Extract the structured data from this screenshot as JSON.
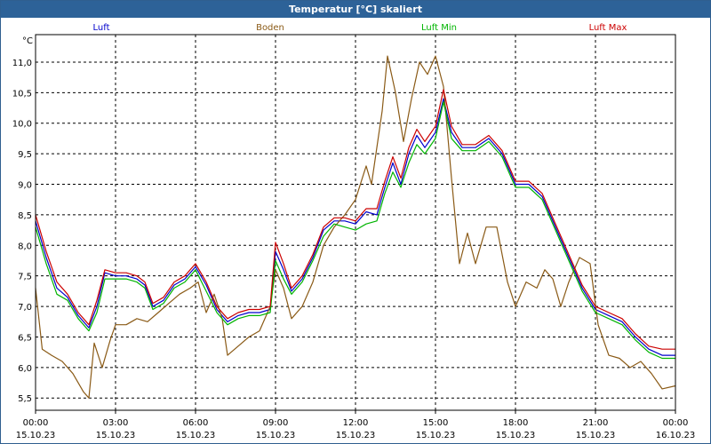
{
  "window": {
    "title": "Temperatur [°C] skaliert"
  },
  "chart_data": {
    "type": "line",
    "title": "Temperatur [°C] skaliert",
    "ylabel": "°C",
    "ylim": [
      5.3,
      11.45
    ],
    "xlim": [
      0,
      24
    ],
    "grid": true,
    "y_ticks": [
      "5,5",
      "6,0",
      "6,5",
      "7,0",
      "7,5",
      "8,0",
      "8,5",
      "9,0",
      "9,5",
      "10,0",
      "10,5",
      "11,0"
    ],
    "x_ticks": [
      {
        "time": "00:00",
        "date": "15.10.23"
      },
      {
        "time": "03:00",
        "date": "15.10.23"
      },
      {
        "time": "06:00",
        "date": "15.10.23"
      },
      {
        "time": "09:00",
        "date": "15.10.23"
      },
      {
        "time": "12:00",
        "date": "15.10.23"
      },
      {
        "time": "15:00",
        "date": "15.10.23"
      },
      {
        "time": "18:00",
        "date": "15.10.23"
      },
      {
        "time": "21:00",
        "date": "15.10.23"
      },
      {
        "time": "00:00",
        "date": "16.10.23"
      }
    ],
    "series": [
      {
        "name": "Luft",
        "color": "#0000cc",
        "points": [
          [
            0,
            8.4
          ],
          [
            0.4,
            7.8
          ],
          [
            0.8,
            7.3
          ],
          [
            1.2,
            7.15
          ],
          [
            1.6,
            6.85
          ],
          [
            2.0,
            6.65
          ],
          [
            2.3,
            7.0
          ],
          [
            2.6,
            7.55
          ],
          [
            3.0,
            7.5
          ],
          [
            3.4,
            7.5
          ],
          [
            3.8,
            7.45
          ],
          [
            4.1,
            7.35
          ],
          [
            4.4,
            7.0
          ],
          [
            4.8,
            7.1
          ],
          [
            5.2,
            7.35
          ],
          [
            5.6,
            7.45
          ],
          [
            6.0,
            7.65
          ],
          [
            6.4,
            7.35
          ],
          [
            6.8,
            6.95
          ],
          [
            7.2,
            6.75
          ],
          [
            7.6,
            6.85
          ],
          [
            8.0,
            6.9
          ],
          [
            8.4,
            6.9
          ],
          [
            8.8,
            6.95
          ],
          [
            9.0,
            7.9
          ],
          [
            9.3,
            7.6
          ],
          [
            9.6,
            7.25
          ],
          [
            10.0,
            7.45
          ],
          [
            10.4,
            7.8
          ],
          [
            10.8,
            8.25
          ],
          [
            11.2,
            8.4
          ],
          [
            11.6,
            8.4
          ],
          [
            12.0,
            8.35
          ],
          [
            12.4,
            8.55
          ],
          [
            12.8,
            8.5
          ],
          [
            13.1,
            8.95
          ],
          [
            13.4,
            9.35
          ],
          [
            13.7,
            9.0
          ],
          [
            14.0,
            9.5
          ],
          [
            14.3,
            9.8
          ],
          [
            14.6,
            9.6
          ],
          [
            15.0,
            9.85
          ],
          [
            15.3,
            10.4
          ],
          [
            15.6,
            9.85
          ],
          [
            16.0,
            9.6
          ],
          [
            16.5,
            9.6
          ],
          [
            17.0,
            9.75
          ],
          [
            17.5,
            9.5
          ],
          [
            18.0,
            9.0
          ],
          [
            18.5,
            9.0
          ],
          [
            19.0,
            8.8
          ],
          [
            19.5,
            8.3
          ],
          [
            20.0,
            7.8
          ],
          [
            20.5,
            7.3
          ],
          [
            21.0,
            6.95
          ],
          [
            21.5,
            6.85
          ],
          [
            22.0,
            6.75
          ],
          [
            22.5,
            6.5
          ],
          [
            23.0,
            6.3
          ],
          [
            23.5,
            6.2
          ],
          [
            24,
            6.2
          ]
        ]
      },
      {
        "name": "Boden",
        "color": "#8a5a16",
        "points": [
          [
            0,
            7.3
          ],
          [
            0.25,
            6.3
          ],
          [
            0.6,
            6.2
          ],
          [
            1.0,
            6.1
          ],
          [
            1.4,
            5.9
          ],
          [
            1.8,
            5.6
          ],
          [
            2.0,
            5.5
          ],
          [
            2.2,
            6.4
          ],
          [
            2.5,
            6.0
          ],
          [
            2.8,
            6.45
          ],
          [
            3.0,
            6.7
          ],
          [
            3.4,
            6.7
          ],
          [
            3.8,
            6.8
          ],
          [
            4.2,
            6.75
          ],
          [
            4.6,
            6.9
          ],
          [
            5.0,
            7.05
          ],
          [
            5.4,
            7.2
          ],
          [
            5.8,
            7.3
          ],
          [
            6.1,
            7.4
          ],
          [
            6.4,
            6.9
          ],
          [
            6.7,
            7.2
          ],
          [
            7.0,
            6.8
          ],
          [
            7.2,
            6.2
          ],
          [
            7.6,
            6.35
          ],
          [
            8.0,
            6.5
          ],
          [
            8.4,
            6.6
          ],
          [
            8.8,
            7.0
          ],
          [
            9.0,
            7.6
          ],
          [
            9.3,
            7.3
          ],
          [
            9.6,
            6.8
          ],
          [
            10.0,
            7.0
          ],
          [
            10.4,
            7.4
          ],
          [
            10.8,
            8.0
          ],
          [
            11.2,
            8.3
          ],
          [
            11.6,
            8.5
          ],
          [
            12.0,
            8.75
          ],
          [
            12.4,
            9.3
          ],
          [
            12.6,
            9.0
          ],
          [
            13.0,
            10.2
          ],
          [
            13.2,
            11.1
          ],
          [
            13.5,
            10.5
          ],
          [
            13.8,
            9.7
          ],
          [
            14.1,
            10.4
          ],
          [
            14.4,
            11.0
          ],
          [
            14.7,
            10.8
          ],
          [
            15.0,
            11.1
          ],
          [
            15.3,
            10.6
          ],
          [
            15.6,
            9.1
          ],
          [
            15.9,
            7.7
          ],
          [
            16.2,
            8.2
          ],
          [
            16.5,
            7.7
          ],
          [
            16.9,
            8.3
          ],
          [
            17.3,
            8.3
          ],
          [
            17.7,
            7.4
          ],
          [
            18.0,
            7.0
          ],
          [
            18.4,
            7.4
          ],
          [
            18.8,
            7.3
          ],
          [
            19.1,
            7.6
          ],
          [
            19.4,
            7.45
          ],
          [
            19.7,
            7.0
          ],
          [
            20.0,
            7.4
          ],
          [
            20.4,
            7.8
          ],
          [
            20.8,
            7.7
          ],
          [
            21.1,
            6.7
          ],
          [
            21.5,
            6.2
          ],
          [
            21.9,
            6.15
          ],
          [
            22.3,
            6.0
          ],
          [
            22.7,
            6.1
          ],
          [
            23.1,
            5.9
          ],
          [
            23.5,
            5.65
          ],
          [
            24,
            5.7
          ]
        ]
      },
      {
        "name": "Luft Min",
        "color": "#00b400",
        "points": [
          [
            0,
            8.3
          ],
          [
            0.4,
            7.7
          ],
          [
            0.8,
            7.2
          ],
          [
            1.2,
            7.1
          ],
          [
            1.6,
            6.8
          ],
          [
            2.0,
            6.6
          ],
          [
            2.3,
            6.9
          ],
          [
            2.6,
            7.45
          ],
          [
            3.0,
            7.45
          ],
          [
            3.4,
            7.45
          ],
          [
            3.8,
            7.4
          ],
          [
            4.1,
            7.3
          ],
          [
            4.4,
            6.95
          ],
          [
            4.8,
            7.05
          ],
          [
            5.2,
            7.3
          ],
          [
            5.6,
            7.4
          ],
          [
            6.0,
            7.6
          ],
          [
            6.4,
            7.25
          ],
          [
            6.8,
            6.9
          ],
          [
            7.2,
            6.7
          ],
          [
            7.6,
            6.8
          ],
          [
            8.0,
            6.85
          ],
          [
            8.4,
            6.85
          ],
          [
            8.8,
            6.9
          ],
          [
            9.0,
            7.75
          ],
          [
            9.3,
            7.45
          ],
          [
            9.6,
            7.2
          ],
          [
            10.0,
            7.4
          ],
          [
            10.4,
            7.75
          ],
          [
            10.8,
            8.15
          ],
          [
            11.2,
            8.35
          ],
          [
            11.6,
            8.3
          ],
          [
            12.0,
            8.25
          ],
          [
            12.4,
            8.35
          ],
          [
            12.8,
            8.4
          ],
          [
            13.1,
            8.85
          ],
          [
            13.4,
            9.2
          ],
          [
            13.7,
            8.95
          ],
          [
            14.0,
            9.35
          ],
          [
            14.3,
            9.65
          ],
          [
            14.6,
            9.5
          ],
          [
            15.0,
            9.75
          ],
          [
            15.3,
            10.35
          ],
          [
            15.6,
            9.75
          ],
          [
            16.0,
            9.55
          ],
          [
            16.5,
            9.55
          ],
          [
            17.0,
            9.7
          ],
          [
            17.5,
            9.45
          ],
          [
            18.0,
            8.95
          ],
          [
            18.5,
            8.95
          ],
          [
            19.0,
            8.75
          ],
          [
            19.5,
            8.25
          ],
          [
            20.0,
            7.75
          ],
          [
            20.5,
            7.25
          ],
          [
            21.0,
            6.9
          ],
          [
            21.5,
            6.8
          ],
          [
            22.0,
            6.7
          ],
          [
            22.5,
            6.45
          ],
          [
            23.0,
            6.25
          ],
          [
            23.5,
            6.15
          ],
          [
            24,
            6.15
          ]
        ]
      },
      {
        "name": "Luft Max",
        "color": "#cc0000",
        "points": [
          [
            0,
            8.5
          ],
          [
            0.4,
            7.9
          ],
          [
            0.8,
            7.4
          ],
          [
            1.2,
            7.2
          ],
          [
            1.6,
            6.9
          ],
          [
            2.0,
            6.7
          ],
          [
            2.3,
            7.1
          ],
          [
            2.6,
            7.6
          ],
          [
            3.0,
            7.55
          ],
          [
            3.4,
            7.55
          ],
          [
            3.8,
            7.5
          ],
          [
            4.1,
            7.4
          ],
          [
            4.4,
            7.05
          ],
          [
            4.8,
            7.15
          ],
          [
            5.2,
            7.4
          ],
          [
            5.6,
            7.5
          ],
          [
            6.0,
            7.7
          ],
          [
            6.4,
            7.4
          ],
          [
            6.8,
            7.0
          ],
          [
            7.2,
            6.8
          ],
          [
            7.6,
            6.9
          ],
          [
            8.0,
            6.95
          ],
          [
            8.4,
            6.95
          ],
          [
            8.8,
            7.0
          ],
          [
            9.0,
            8.05
          ],
          [
            9.3,
            7.7
          ],
          [
            9.6,
            7.3
          ],
          [
            10.0,
            7.5
          ],
          [
            10.4,
            7.85
          ],
          [
            10.8,
            8.3
          ],
          [
            11.2,
            8.45
          ],
          [
            11.6,
            8.45
          ],
          [
            12.0,
            8.4
          ],
          [
            12.4,
            8.6
          ],
          [
            12.8,
            8.6
          ],
          [
            13.1,
            9.05
          ],
          [
            13.4,
            9.45
          ],
          [
            13.7,
            9.1
          ],
          [
            14.0,
            9.6
          ],
          [
            14.3,
            9.9
          ],
          [
            14.6,
            9.7
          ],
          [
            15.0,
            9.95
          ],
          [
            15.3,
            10.55
          ],
          [
            15.6,
            9.95
          ],
          [
            16.0,
            9.65
          ],
          [
            16.5,
            9.65
          ],
          [
            17.0,
            9.8
          ],
          [
            17.5,
            9.55
          ],
          [
            18.0,
            9.05
          ],
          [
            18.5,
            9.05
          ],
          [
            19.0,
            8.85
          ],
          [
            19.5,
            8.35
          ],
          [
            20.0,
            7.85
          ],
          [
            20.5,
            7.35
          ],
          [
            21.0,
            7.0
          ],
          [
            21.5,
            6.9
          ],
          [
            22.0,
            6.8
          ],
          [
            22.5,
            6.55
          ],
          [
            23.0,
            6.35
          ],
          [
            23.5,
            6.3
          ],
          [
            24,
            6.3
          ]
        ]
      }
    ]
  }
}
